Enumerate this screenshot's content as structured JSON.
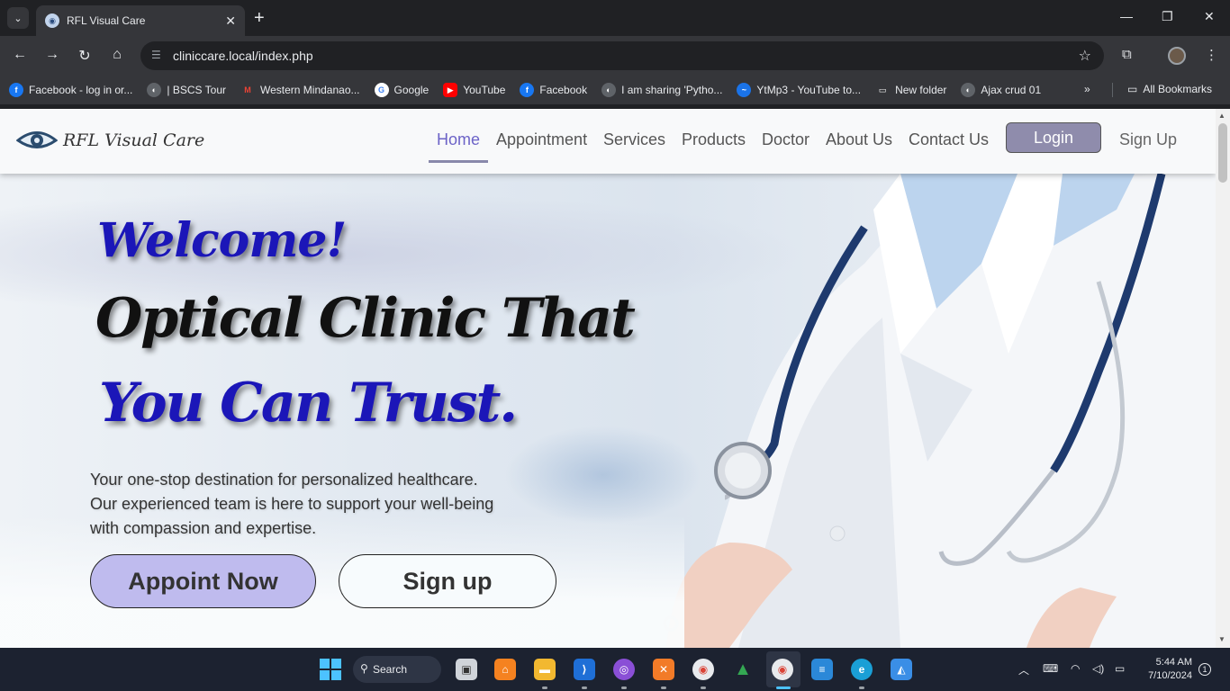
{
  "browser": {
    "tab_title": "RFL Visual Care",
    "url": "cliniccare.local/index.php",
    "bookmarks": [
      {
        "label": "Facebook - log in or...",
        "icon": "facebook-icon",
        "color": "#1877f2"
      },
      {
        "label": "| BSCS Tour",
        "icon": "globe-icon",
        "color": "#9aa0a6"
      },
      {
        "label": "Western Mindanao...",
        "icon": "gmail-icon",
        "color": "#ea4335"
      },
      {
        "label": "Google",
        "icon": "google-icon",
        "color": "#ffffff"
      },
      {
        "label": "YouTube",
        "icon": "youtube-icon",
        "color": "#ff0000"
      },
      {
        "label": "Facebook",
        "icon": "facebook-icon",
        "color": "#1877f2"
      },
      {
        "label": "I am sharing 'Pytho...",
        "icon": "globe-icon",
        "color": "#9aa0a6"
      },
      {
        "label": "YtMp3 - YouTube to...",
        "icon": "ytmp3-icon",
        "color": "#1a73e8"
      },
      {
        "label": "New folder",
        "icon": "folder-icon",
        "color": "#e8eaed"
      },
      {
        "label": "Ajax crud 01",
        "icon": "globe-icon",
        "color": "#9aa0a6"
      }
    ],
    "all_bookmarks": "All Bookmarks"
  },
  "site": {
    "brand": "RFL Visual Care",
    "nav": [
      {
        "label": "Home",
        "active": true
      },
      {
        "label": "Appointment",
        "active": false
      },
      {
        "label": "Services",
        "active": false
      },
      {
        "label": "Products",
        "active": false
      },
      {
        "label": "Doctor",
        "active": false
      },
      {
        "label": "About Us",
        "active": false
      },
      {
        "label": "Contact Us",
        "active": false
      }
    ],
    "login_label": "Login",
    "signup_label": "Sign Up",
    "accent_color": "#6c63c7"
  },
  "hero": {
    "welcome": "Welcome!",
    "headline_line1": "Optical Clinic That",
    "headline_line2": "You Can Trust.",
    "tagline_line1": "Your one-stop destination for personalized healthcare.",
    "tagline_line2": "Our experienced team is here to support your well-being",
    "tagline_line3": "with compassion and expertise.",
    "appoint_button": "Appoint Now",
    "signup_button": "Sign up",
    "headline_color": "#1b16b8"
  },
  "taskbar": {
    "search_label": "Search",
    "time": "5:44 AM",
    "date": "7/10/2024",
    "notifications": "1"
  }
}
